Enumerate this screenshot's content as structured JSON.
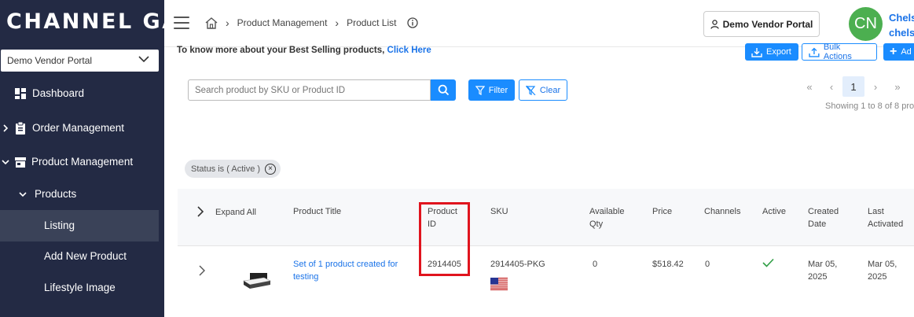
{
  "sidebar": {
    "logo": "CHANNEL GATE",
    "vendor_select": "Demo Vendor Portal",
    "items": [
      {
        "label": "Dashboard"
      },
      {
        "label": "Order Management"
      },
      {
        "label": "Product Management"
      },
      {
        "label": "Products"
      },
      {
        "label": "Listing"
      },
      {
        "label": "Add New Product"
      },
      {
        "label": "Lifestyle Image"
      }
    ]
  },
  "topbar": {
    "breadcrumbs": [
      "Product Management",
      "Product List"
    ],
    "portal_button": "Demo Vendor Portal",
    "avatar_initials": "CN",
    "user_name": "Chels",
    "user_email": "chelse"
  },
  "content": {
    "bestselling_text": "To know more about your Best Selling products,",
    "bestselling_link": "Click Here",
    "export_label": "Export",
    "bulk_actions_label": "Bulk Actions",
    "add_label": "Ad",
    "search_placeholder": "Search product by SKU or Product ID",
    "filter_label": "Filter",
    "clear_label": "Clear",
    "pagination": {
      "current_page": "1",
      "showing": "Showing 1 to 8 of 8 pro"
    },
    "filter_chip": "Status is ( Active )"
  },
  "table": {
    "expand_all": "Expand All",
    "headers": {
      "title": "Product Title",
      "product_id_1": "Product",
      "product_id_2": "ID",
      "sku": "SKU",
      "qty_1": "Available",
      "qty_2": "Qty",
      "price": "Price",
      "channels": "Channels",
      "active": "Active",
      "created_1": "Created",
      "created_2": "Date",
      "last_1": "Last",
      "last_2": "Activated"
    },
    "rows": [
      {
        "title_1": "Set of 1 product created for",
        "title_2": "testing",
        "product_id": "2914405",
        "sku": "2914405-PKG",
        "qty": "0",
        "price": "$518.42",
        "channels": "0",
        "active": true,
        "created_1": "Mar 05,",
        "created_2": "2025",
        "last_1": "Mar 05,",
        "last_2": "2025"
      }
    ]
  },
  "colors": {
    "sidebar_bg": "#232a44",
    "accent": "#1a8cff",
    "highlight": "#e0141e",
    "avatar": "#4caf50"
  }
}
